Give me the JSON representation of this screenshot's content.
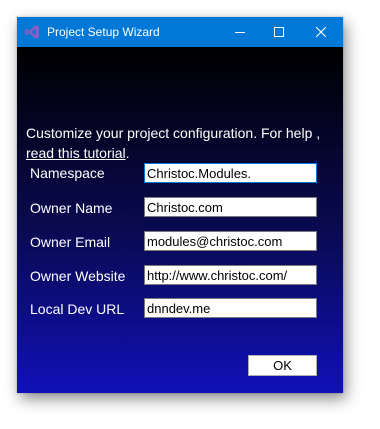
{
  "window": {
    "title": "Project Setup Wizard",
    "icon": "visual-studio-icon",
    "controls": [
      "minimize-icon",
      "maximize-icon",
      "close-icon"
    ]
  },
  "intro": {
    "text": "Customize your project configuration. For help ,",
    "link_text": "read this tutorial",
    "suffix": "."
  },
  "fields": [
    {
      "label": "Namespace",
      "value": "Christoc.Modules."
    },
    {
      "label": "Owner Name",
      "value": "Christoc.com"
    },
    {
      "label": "Owner Email",
      "value": "modules@christoc.com"
    },
    {
      "label": "Owner Website",
      "value": "http://www.christoc.com/"
    },
    {
      "label": "Local Dev URL",
      "value": "dnndev.me"
    }
  ],
  "buttons": {
    "ok_label": "OK"
  },
  "colors": {
    "titlebar": "#0078d7",
    "gradient_top": "#000000",
    "gradient_bottom": "#1010b8",
    "icon_purple": "#865fc5"
  }
}
